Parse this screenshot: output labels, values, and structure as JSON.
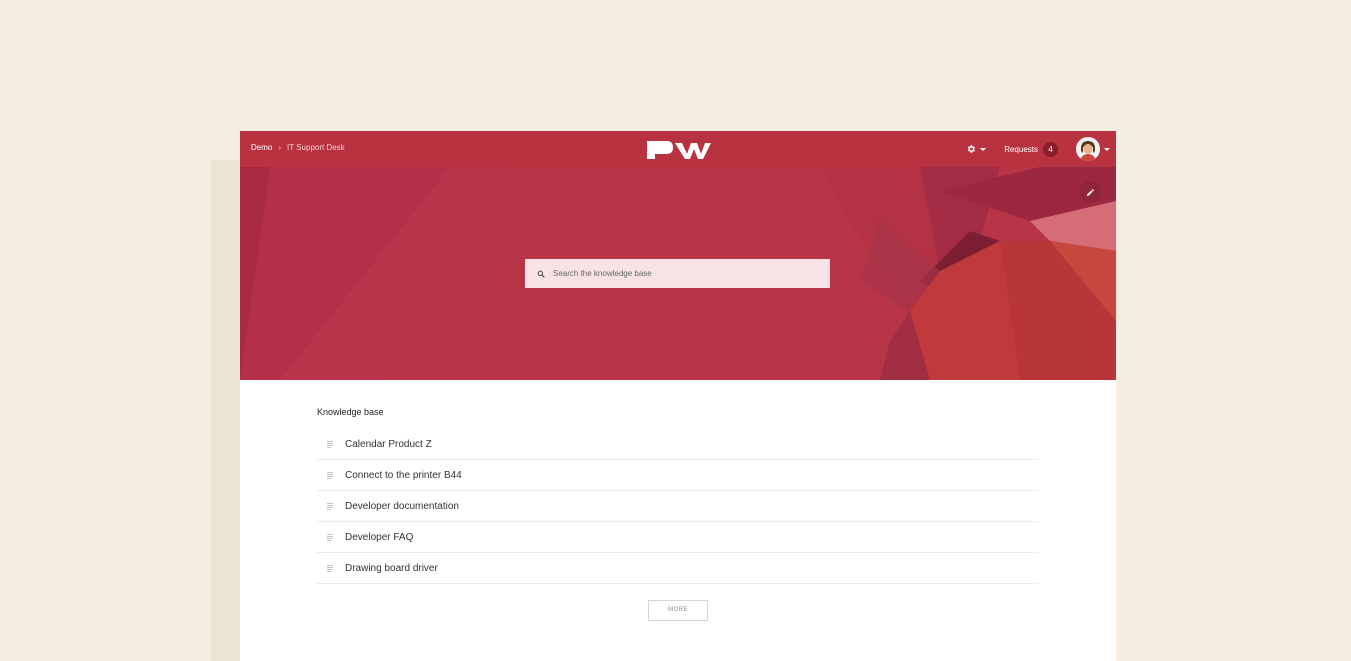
{
  "breadcrumb": {
    "home": "Demo",
    "separator": "›",
    "current": "IT Support Desk"
  },
  "logo": {
    "icon": "pw-logo-icon"
  },
  "nav": {
    "settings_icon": "gear-icon",
    "requests_label": "Requests",
    "requests_count": "4",
    "avatar_icon": "avatar-icon"
  },
  "hero": {
    "edit_icon": "pencil-icon"
  },
  "search": {
    "placeholder": "Search the knowledge base",
    "value": ""
  },
  "knowledge_base": {
    "title": "Knowledge base",
    "items": [
      {
        "label": "Calendar Product Z"
      },
      {
        "label": "Connect to the printer B44"
      },
      {
        "label": "Developer documentation"
      },
      {
        "label": "Developer FAQ"
      },
      {
        "label": "Drawing board driver"
      }
    ],
    "more_label": "MORE"
  },
  "colors": {
    "brand": "#b8323f",
    "background": "#f4ede0",
    "badge": "#8a1d2a"
  }
}
